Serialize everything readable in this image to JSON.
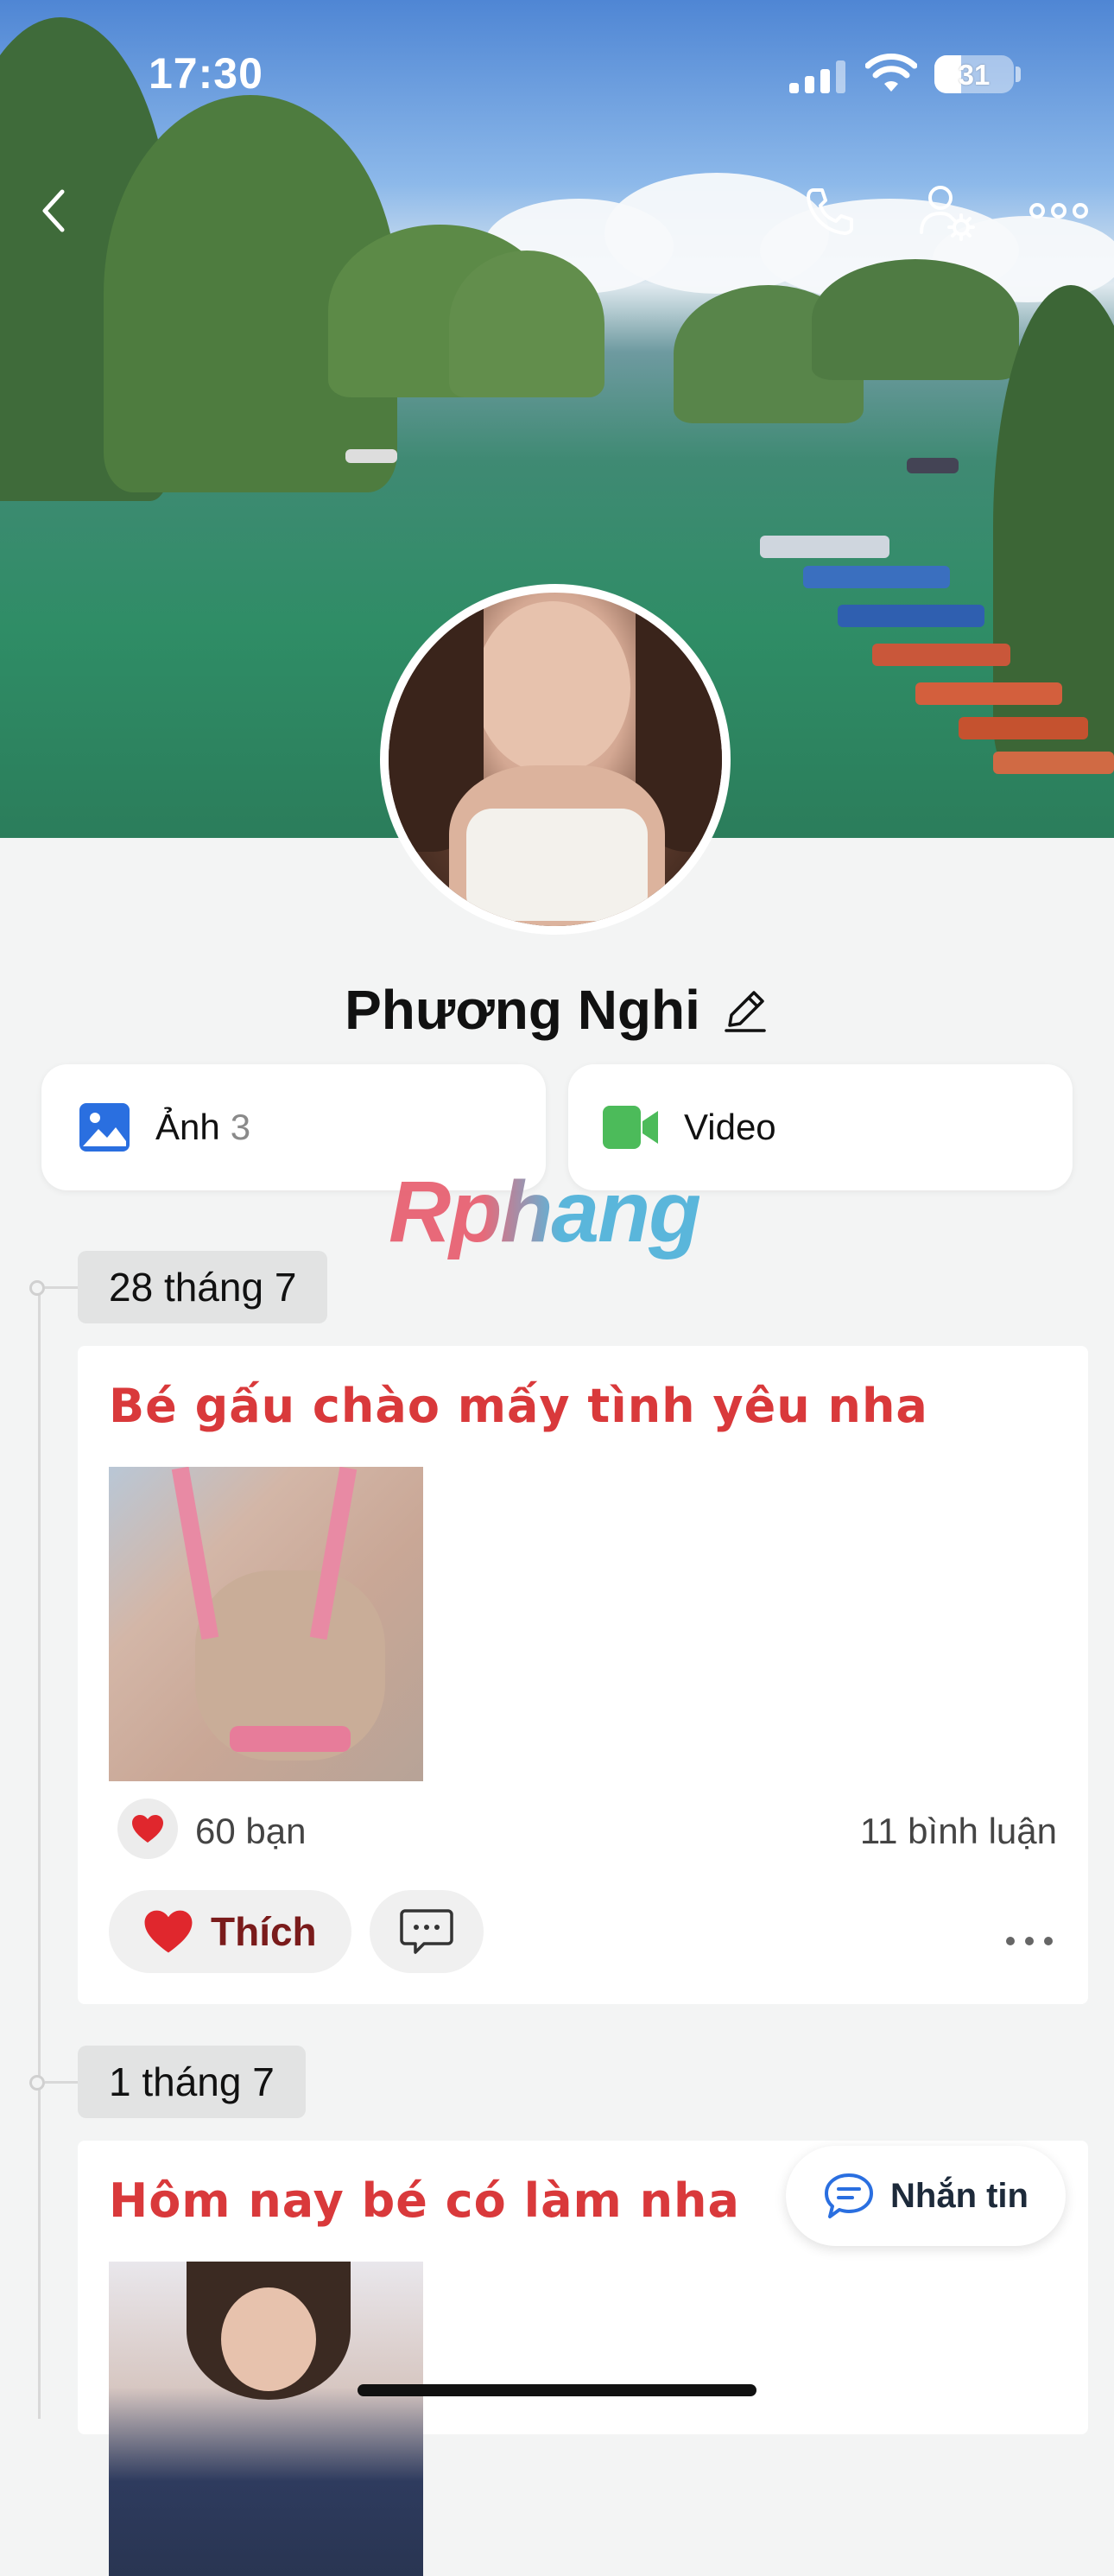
{
  "status_bar": {
    "time": "17:30",
    "battery": "31"
  },
  "header": {
    "back_icon": "chevron-left-icon",
    "call_icon": "phone-icon",
    "settings_icon": "user-gear-icon",
    "more_icon": "ellipsis-icon"
  },
  "profile": {
    "name": "Phương Nghi",
    "edit_icon": "pencil-icon"
  },
  "media": {
    "photos_label": "Ảnh",
    "photos_count": "3",
    "video_label": "Video"
  },
  "watermark": "Rphang",
  "posts": [
    {
      "date": "28 tháng 7",
      "title": "Bé gấu chào mấy tình yêu nha",
      "likes": "60 bạn",
      "comments": "11 bình luận",
      "like_label": "Thích"
    },
    {
      "date": "1 tháng 7",
      "title": "Hôm nay bé có làm nha"
    }
  ],
  "message_button": "Nhắn tin",
  "colors": {
    "title_red": "#d9393b",
    "video_green": "#4cbb5a",
    "photo_blue": "#2a6fe0"
  }
}
